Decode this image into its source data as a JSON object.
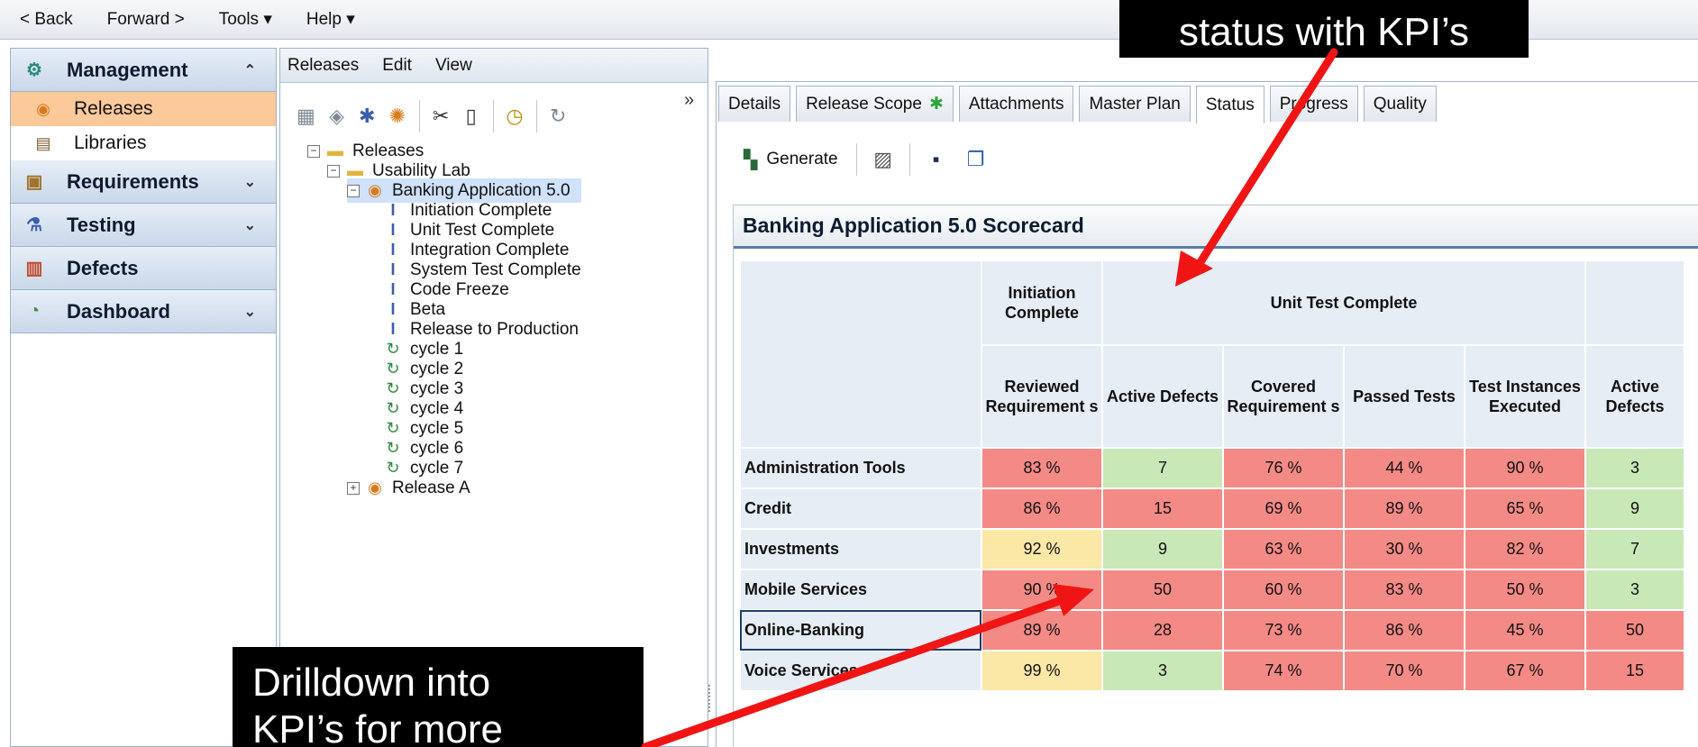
{
  "topbar": {
    "back": "< Back",
    "forward": "Forward >",
    "tools": "Tools ▾",
    "help": "Help ▾"
  },
  "leftnav": {
    "management": "Management",
    "releases": "Releases",
    "libraries": "Libraries",
    "requirements": "Requirements",
    "testing": "Testing",
    "defects": "Defects",
    "dashboard": "Dashboard"
  },
  "midmenu": {
    "releases": "Releases",
    "edit": "Edit",
    "view": "View"
  },
  "tree": {
    "root": "Releases",
    "folder": "Usability Lab",
    "release": "Banking Application 5.0",
    "milestones": [
      "Initiation Complete",
      "Unit Test Complete",
      "Integration Complete",
      "System Test Complete",
      "Code Freeze",
      "Beta",
      "Release to Production"
    ],
    "cycles": [
      "cycle 1",
      "cycle 2",
      "cycle 3",
      "cycle 4",
      "cycle 5",
      "cycle 6",
      "cycle 7"
    ],
    "release_a": "Release A"
  },
  "tabs": {
    "details": "Details",
    "scope": "Release Scope",
    "attachments": "Attachments",
    "masterplan": "Master Plan",
    "status": "Status",
    "progress": "Progress",
    "quality": "Quality"
  },
  "toolbar": {
    "generate": "Generate"
  },
  "scorecard": {
    "title": "Banking Application 5.0 Scorecard",
    "group1": "Initiation Complete",
    "group2": "Unit Test Complete",
    "columns": [
      "Reviewed Requirement s",
      "Active Defects",
      "Covered Requirement s",
      "Passed Tests",
      "Test Instances Executed",
      "Active Defects"
    ],
    "rows": [
      {
        "name": "Administration Tools",
        "values": [
          "83 %",
          "7",
          "76 %",
          "44 %",
          "90 %",
          "3"
        ],
        "status": [
          "r",
          "g",
          "r",
          "r",
          "r",
          "g"
        ]
      },
      {
        "name": "Credit",
        "values": [
          "86 %",
          "15",
          "69 %",
          "89 %",
          "65 %",
          "9"
        ],
        "status": [
          "r",
          "r",
          "r",
          "r",
          "r",
          "g"
        ]
      },
      {
        "name": "Investments",
        "values": [
          "92 %",
          "9",
          "63 %",
          "30 %",
          "82 %",
          "7"
        ],
        "status": [
          "y",
          "g",
          "r",
          "r",
          "r",
          "g"
        ]
      },
      {
        "name": "Mobile Services",
        "values": [
          "90 %",
          "50",
          "60 %",
          "83 %",
          "50 %",
          "3"
        ],
        "status": [
          "r",
          "r",
          "r",
          "r",
          "r",
          "g"
        ]
      },
      {
        "name": "Online-Banking",
        "values": [
          "89 %",
          "28",
          "73 %",
          "86 %",
          "45 %",
          "50"
        ],
        "status": [
          "r",
          "r",
          "r",
          "r",
          "r",
          "r"
        ]
      },
      {
        "name": "Voice Services",
        "values": [
          "99 %",
          "3",
          "74 %",
          "70 %",
          "67 %",
          "15"
        ],
        "status": [
          "y",
          "g",
          "r",
          "r",
          "r",
          "r"
        ]
      }
    ]
  },
  "callouts": {
    "top": "status with KPI’s",
    "bottom_line1": "Drilldown into",
    "bottom_line2": "KPI’s for more"
  },
  "colors": {
    "red_cell": "#f48a86",
    "green_cell": "#c8e8b7",
    "yellow_cell": "#fbe7a6",
    "selected_nav": "#fcc99a",
    "arrow": "#f01515"
  },
  "icons": {
    "management": "management-icon",
    "releases": "release-icon",
    "libraries": "library-icon",
    "requirements": "requirements-icon",
    "testing": "flask-icon",
    "defects": "defect-icon",
    "dashboard": "dashboard-gauge-icon"
  }
}
